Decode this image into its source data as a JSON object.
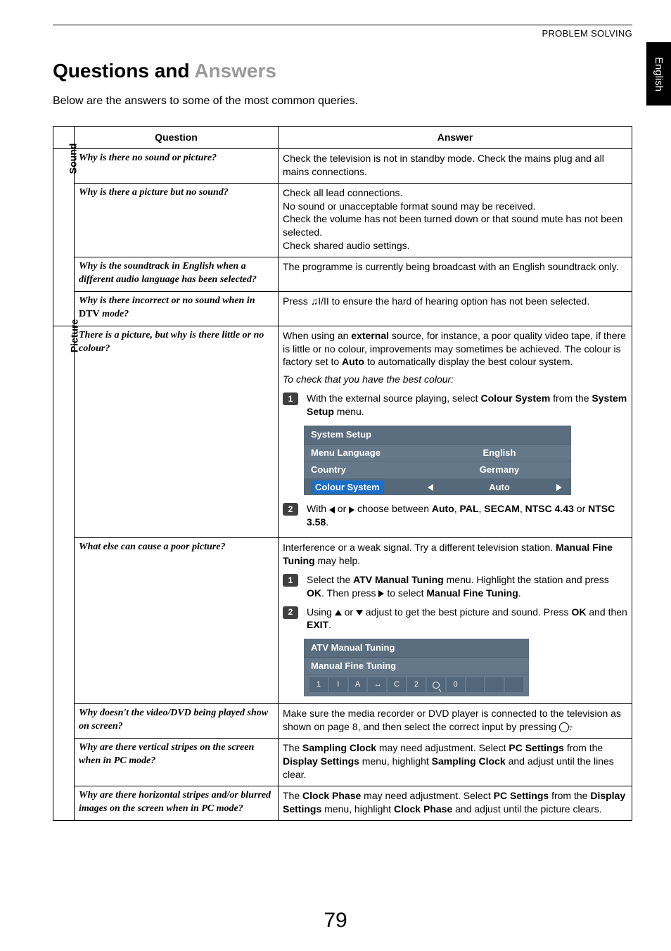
{
  "running_head": "PROBLEM SOLVING",
  "side_tab": "English",
  "title_black": "Questions and ",
  "title_grey": "Answers",
  "intro": "Below are the answers to some of the most common queries.",
  "headers": {
    "q": "Question",
    "a": "Answer"
  },
  "categories": {
    "sound": "Sound",
    "picture": "Picture"
  },
  "sound": {
    "q1": "Why is there no sound or picture?",
    "a1": "Check the television is not in standby mode. Check the mains plug and all mains connections.",
    "q2": "Why is there a picture but no sound?",
    "a2_l1": "Check all lead connections.",
    "a2_l2": "No sound or unacceptable format sound may be received.",
    "a2_l3": "Check the volume has not been turned down or that sound mute has not been selected.",
    "a2_l4": "Check shared audio settings.",
    "q3": "Why is the soundtrack in English when a different audio language has been selected?",
    "a3": "The programme is currently being broadcast with an English soundtrack only.",
    "q4_pre": "Why is there incorrect or no sound when in ",
    "q4_b": "DTV",
    "q4_post": " mode?",
    "a4_pre": "Press ",
    "a4_post": " to ensure the hard of hearing option has not been selected."
  },
  "picture": {
    "q1": "There is a picture, but why is there little or no colour?",
    "a1_p1_pre": "When using an ",
    "a1_p1_b1": "external",
    "a1_p1_mid": " source, for instance, a poor quality video tape, if there is little or no colour, improvements may sometimes be achieved. The colour is factory set to ",
    "a1_p1_b2": "Auto",
    "a1_p1_post": " to automatically display the best colour system.",
    "a1_note": "To check that you have the best colour:",
    "a1_s1_pre": "With the external source playing, select ",
    "a1_s1_b1": "Colour System",
    "a1_s1_mid": " from the ",
    "a1_s1_b2": "System Setup",
    "a1_s1_post": " menu.",
    "menu1": {
      "title": "System Setup",
      "row1_l": "Menu Language",
      "row1_v": "English",
      "row2_l": "Country",
      "row2_v": "Germany",
      "row3_l": "Colour System",
      "row3_v": "Auto"
    },
    "a1_s2_pre": "With ",
    "a1_s2_mid": " or ",
    "a1_s2_mid2": " choose between ",
    "a1_s2_opts": "Auto, PAL, SECAM, NTSC 4.43",
    "a1_s2_or": " or ",
    "a1_s2_last": "NTSC 3.58",
    "a1_s2_dot": ".",
    "q2": "What else can cause a poor picture?",
    "a2_p1_pre": "Interference or a weak signal. Try a different television station. ",
    "a2_p1_b": "Manual Fine Tuning",
    "a2_p1_post": " may help.",
    "a2_s1_pre": "Select the ",
    "a2_s1_b1": "ATV Manual Tuning",
    "a2_s1_mid": " menu. Highlight the station and press ",
    "a2_s1_b2": "OK",
    "a2_s1_mid2": ". Then press ",
    "a2_s1_mid3": " to select ",
    "a2_s1_b3": "Manual Fine Tuning",
    "a2_s1_dot": ".",
    "a2_s2_pre": "Using ",
    "a2_s2_mid": " or ",
    "a2_s2_mid2": " adjust to get the best picture and sound. Press ",
    "a2_s2_b1": "OK",
    "a2_s2_mid3": " and then ",
    "a2_s2_b2": "EXIT",
    "a2_s2_dot": ".",
    "menu2": {
      "title": "ATV Manual Tuning",
      "sub": "Manual Fine Tuning",
      "cells": [
        "1",
        "I",
        "A",
        "↔",
        "C",
        "2",
        "",
        "0",
        "",
        "",
        ""
      ]
    },
    "q3": "Why doesn't the video/DVD being played show on screen?",
    "a3_pre": "Make sure the media recorder or DVD player is connected to the television as shown on page 8, and then select the correct input by pressing ",
    "a3_post": ".",
    "q4": "Why are there vertical stripes on the screen when in PC mode?",
    "a4_pre": "The ",
    "a4_b1": "Sampling Clock",
    "a4_mid1": " may need adjustment. Select ",
    "a4_b2": "PC Settings",
    "a4_mid2": " from the ",
    "a4_b3": "Display Settings",
    "a4_mid3": " menu, highlight ",
    "a4_b4": "Sampling Clock",
    "a4_post": " and adjust until the lines clear.",
    "q5": "Why are there horizontal stripes and/or blurred images on the screen when in PC mode?",
    "a5_pre": "The ",
    "a5_b1": "Clock Phase",
    "a5_mid1": " may need adjustment. Select ",
    "a5_b2": "PC Settings",
    "a5_mid2": " from the ",
    "a5_b3": "Display Settings",
    "a5_mid3": " menu, highlight ",
    "a5_b4": "Clock Phase",
    "a5_post": " and adjust until the picture clears."
  },
  "page_number": "79"
}
